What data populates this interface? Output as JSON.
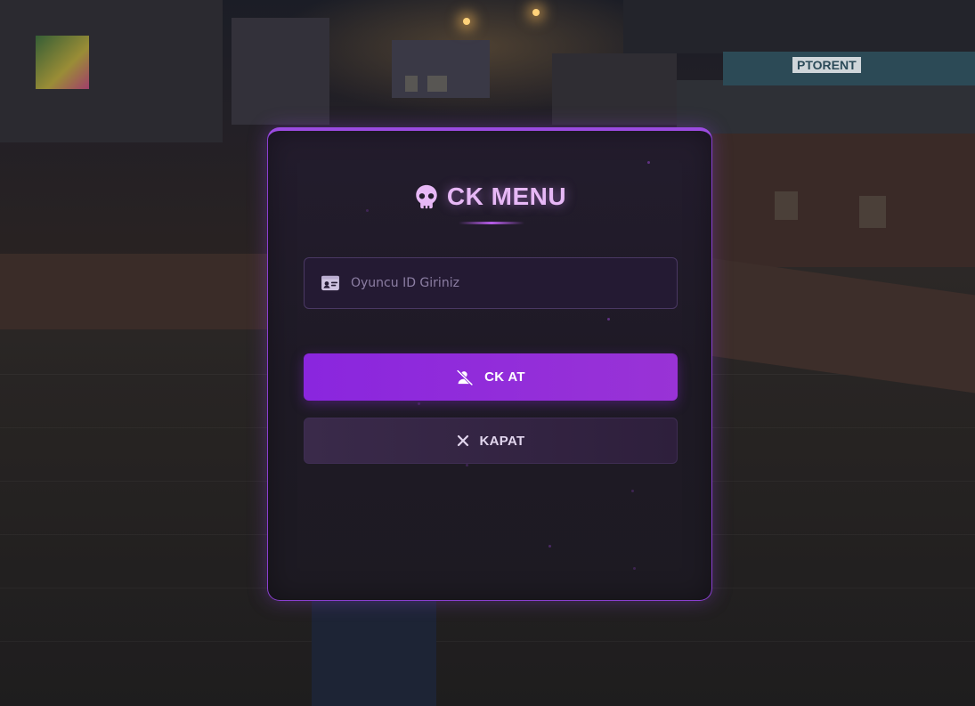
{
  "scene": {
    "rent_sign_text": "PTORENT"
  },
  "menu": {
    "title": "CK MENU",
    "title_icon": "skull-icon",
    "player_id_input": {
      "placeholder": "Oyuncu ID Giriniz",
      "value": "",
      "icon": "id-card-icon"
    },
    "ck_button": {
      "label": "CK AT",
      "icon": "user-slash-icon"
    },
    "close_button": {
      "label": "KAPAT",
      "icon": "close-icon"
    }
  },
  "colors": {
    "accent": "#9b4be0",
    "title": "#e7b8f6",
    "primary_button": "#8a26de",
    "secondary_button": "#3a2a4a",
    "panel_bg": "#1e1a25"
  }
}
